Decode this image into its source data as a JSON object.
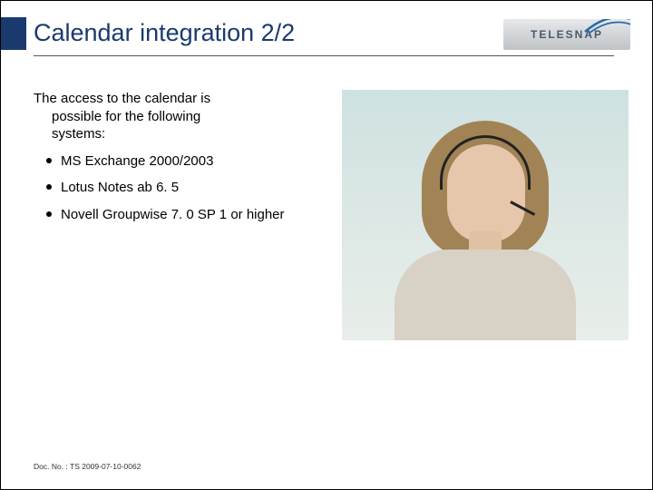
{
  "header": {
    "title": "Calendar integration 2/2",
    "logo_text": "TELESNAP"
  },
  "content": {
    "intro_line1": "The access to the calendar is",
    "intro_line2": "possible for the following",
    "intro_line3": "systems:",
    "bullets": [
      "MS Exchange 2000/2003",
      "Lotus Notes ab 6. 5",
      "Novell Groupwise  7. 0 SP 1 or higher"
    ]
  },
  "footer": {
    "docnum": "Doc. No. : TS 2009-07-10-0062"
  }
}
